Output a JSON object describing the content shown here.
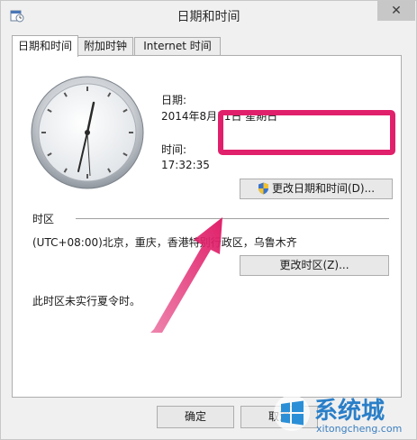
{
  "window": {
    "title": "日期和时间",
    "close_label": "✕",
    "icon": "datetime-app-icon"
  },
  "tabs": [
    {
      "label": "日期和时间",
      "active": true
    },
    {
      "label": "附加时钟",
      "active": false
    },
    {
      "label": "Internet 时间",
      "active": false
    }
  ],
  "datetime": {
    "date_label": "日期:",
    "date_value": "2014年8月31日 星期日",
    "time_label": "时间:",
    "time_value": "17:32:35",
    "change_button": "更改日期和时间(D)...",
    "change_icon": "uac-shield-icon"
  },
  "timezone": {
    "section_label": "时区",
    "value": "(UTC+08:00)北京，重庆，香港特别行政区，乌鲁木齐",
    "change_button": "更改时区(Z)...",
    "dst_note": "此时区未实行夏令时。"
  },
  "footer": {
    "ok_button": "确定",
    "cancel_button": "取消"
  },
  "watermark": {
    "text": "系统城",
    "url": "xitongcheng.com"
  },
  "colors": {
    "highlight": "#e0206a",
    "window_bg": "#f0f0f0"
  }
}
